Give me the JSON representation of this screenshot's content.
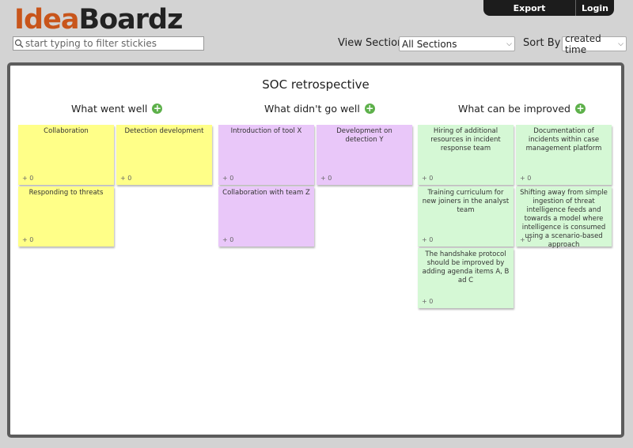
{
  "app": {
    "logo_part1": "Idea",
    "logo_part2": "Boardz"
  },
  "topbar": {
    "export_label": "Export",
    "login_label": "Login"
  },
  "filter": {
    "placeholder": "start typing to filter stickies",
    "icon": "search-icon"
  },
  "view_section": {
    "label": "View Section",
    "selected": "All Sections"
  },
  "sort_by": {
    "label": "Sort By",
    "selected": "created time"
  },
  "board": {
    "title": "SOC retrospective",
    "sections": [
      {
        "title": "What went well",
        "color": "#ffff88",
        "stickies": [
          {
            "text": "Collaboration",
            "votes": "+ 0"
          },
          {
            "text": "Detection development",
            "votes": "+ 0"
          },
          {
            "text": "Responding to threats",
            "votes": "+ 0"
          }
        ]
      },
      {
        "title": "What didn't go well",
        "color": "#e9c7f9",
        "stickies": [
          {
            "text": "Introduction of tool X",
            "votes": "+ 0"
          },
          {
            "text": "Development on detection Y",
            "votes": "+ 0"
          },
          {
            "text": "Collaboration with team Z",
            "votes": "+ 0"
          }
        ]
      },
      {
        "title": "What can be improved",
        "color": "#d5f8d5",
        "stickies": [
          {
            "text": "Hiring of additional resources in incident response team",
            "votes": "+ 0"
          },
          {
            "text": "Documentation of incidents within case management platform",
            "votes": "+ 0"
          },
          {
            "text": "Training curriculum for new joiners in the analyst team",
            "votes": "+ 0"
          },
          {
            "text": "Shifting away from simple ingestion of threat intelligence feeds and towards a model where intelligence is consumed using a scenario-based approach",
            "votes": "+ 0"
          },
          {
            "text": "The handshake protocol should be improved by adding agenda items A, B ad C",
            "votes": "+ 0"
          }
        ]
      }
    ]
  },
  "colors": {
    "logo_accent": "#c8551b",
    "add_button": "#5db04a",
    "board_frame": "#5c5c5c",
    "topbar_bg": "#1c1c1c"
  }
}
